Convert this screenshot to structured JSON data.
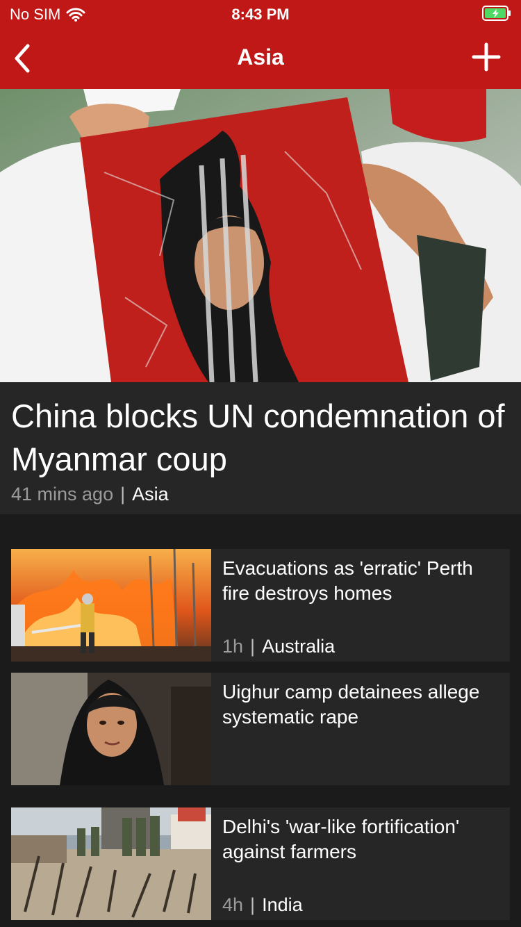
{
  "status_bar": {
    "carrier": "No SIM",
    "time": "8:43 PM",
    "icons": [
      "wifi-icon",
      "battery-charging-icon"
    ]
  },
  "nav": {
    "title": "Asia",
    "back_icon": "chevron-left-icon",
    "add_icon": "plus-icon"
  },
  "hero": {
    "image": "protest-poster-myanmar-photo",
    "headline": "China blocks UN condemnation of Myanmar coup",
    "time": "41 mins ago",
    "separator": "|",
    "category": "Asia"
  },
  "stories": [
    {
      "image": "bushfire-firefighter-photo",
      "headline": "Evacuations as 'erratic' Perth fire destroys homes",
      "time": "1h",
      "separator": "|",
      "category": "Australia"
    },
    {
      "image": "woman-portrait-photo",
      "headline": "Uighur camp detainees allege systematic rape",
      "time": "",
      "separator": "",
      "category": ""
    },
    {
      "image": "police-barricade-spikes-photo",
      "headline": "Delhi's 'war-like fortification' against farmers",
      "time": "4h",
      "separator": "|",
      "category": "India"
    }
  ],
  "colors": {
    "brand_red": "#c01717",
    "background": "#1b1b1b",
    "card": "#262626",
    "meta_gray": "#9b9b9b"
  }
}
